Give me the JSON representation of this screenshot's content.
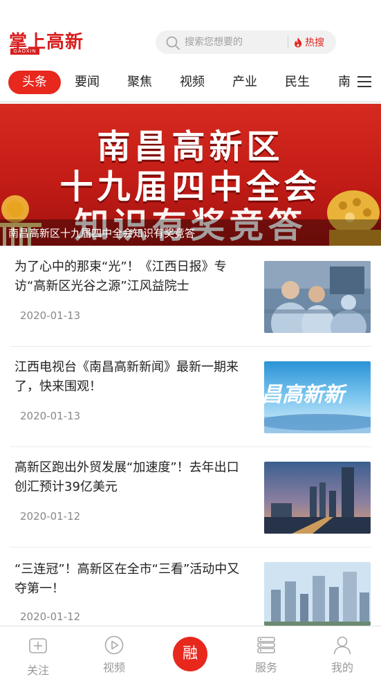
{
  "app": {
    "logo_text": "掌上高新",
    "logo_sub": "GAOXIN"
  },
  "search": {
    "placeholder": "搜索您想要的",
    "hot_label": "热搜"
  },
  "tabs": [
    {
      "label": "头条",
      "active": true
    },
    {
      "label": "要闻"
    },
    {
      "label": "聚焦"
    },
    {
      "label": "视频"
    },
    {
      "label": "产业"
    },
    {
      "label": "民生"
    },
    {
      "label": "南"
    }
  ],
  "banner": {
    "line1": "南昌高新区",
    "line2": "十九届四中全会",
    "line3": "知识有奖竞答",
    "caption": "南昌高新区十九届四中全会知识有奖竞答"
  },
  "news": [
    {
      "title": "为了心中的那束“光”！《江西日报》专访“高新区光谷之源”江风益院士",
      "date": "2020-01-13"
    },
    {
      "title": "江西电视台《南昌高新新闻》最新一期来了，快来围观！",
      "date": "2020-01-13",
      "thumb_text": "昌高新新"
    },
    {
      "title": "高新区跑出外贸发展“加速度”！去年出口创汇预计39亿美元",
      "date": "2020-01-12"
    },
    {
      "title": "“三连冠”！高新区在全市“三看”活动中又夺第一！",
      "date": "2020-01-12"
    }
  ],
  "bottom_nav": {
    "follow": "关注",
    "video": "视频",
    "center": "融",
    "service": "服务",
    "mine": "我的"
  },
  "colors": {
    "accent": "#e8271d",
    "brand": "#d81e1e",
    "muted": "#999999"
  }
}
